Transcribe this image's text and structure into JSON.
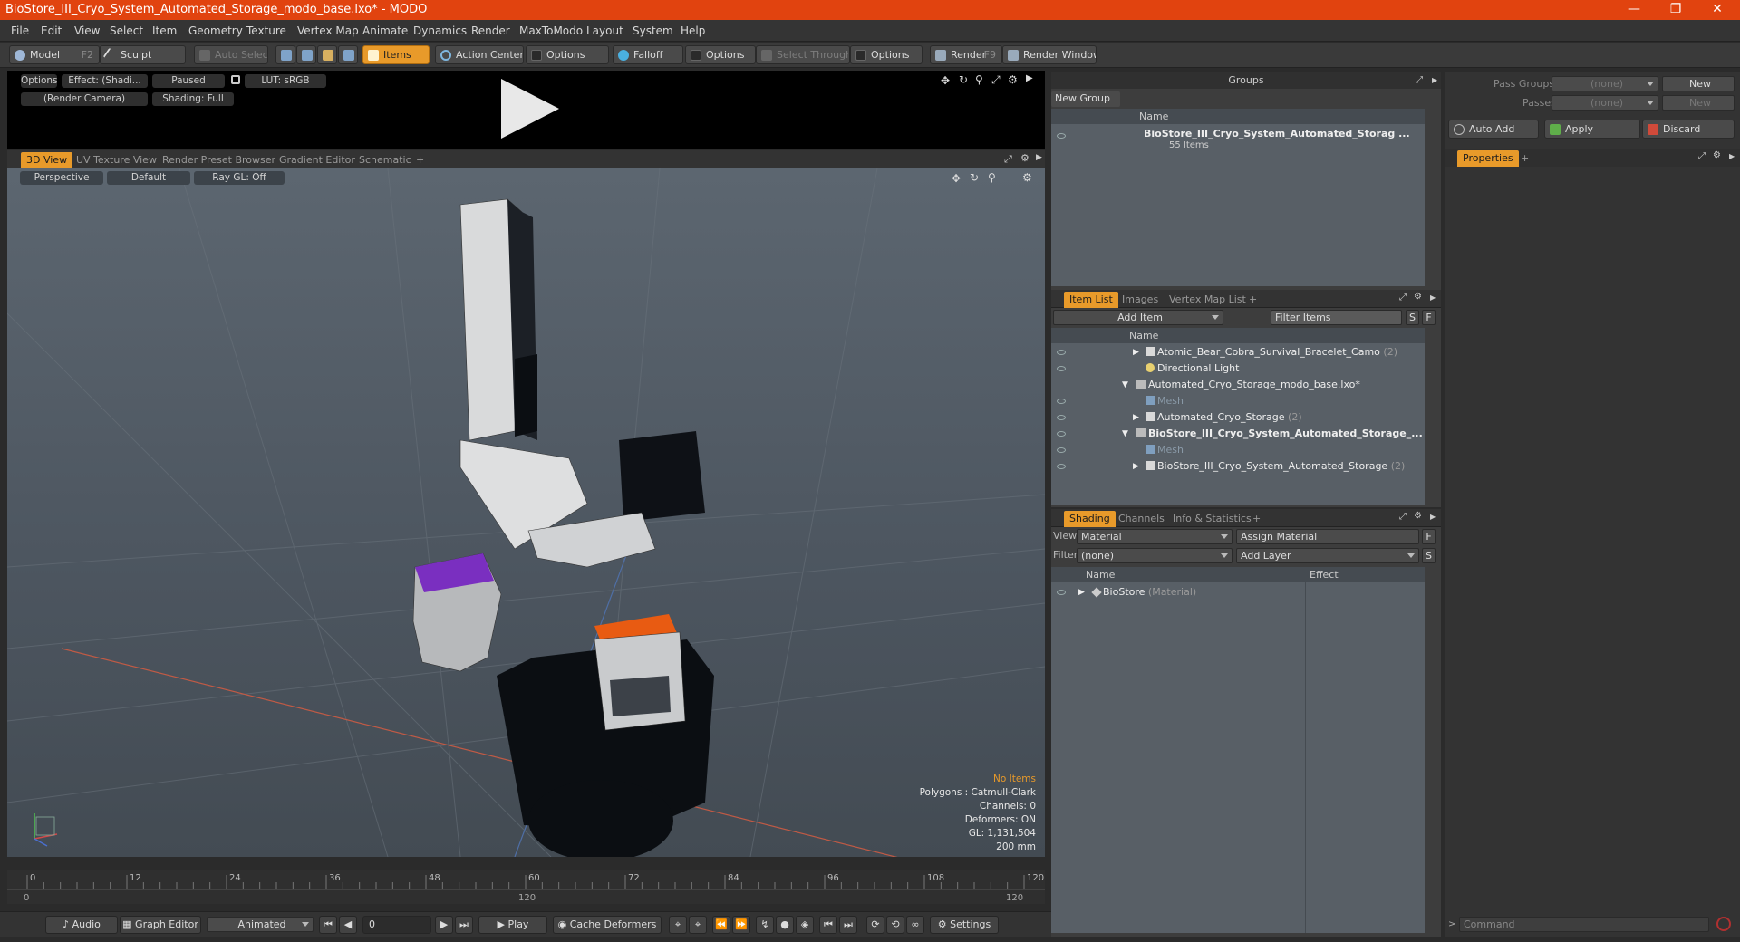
{
  "window": {
    "title": "BioStore_III_Cryo_System_Automated_Storage_modo_base.lxo* - MODO",
    "minimize": "—",
    "maximize": "❐",
    "close": "✕"
  },
  "menu": [
    "File",
    "Edit",
    "View",
    "Select",
    "Item",
    "Geometry",
    "Texture",
    "Vertex Map",
    "Animate",
    "Dynamics",
    "Render",
    "MaxToModo",
    "Layout",
    "System",
    "Help"
  ],
  "toolbar": {
    "model": "Model",
    "model_key": "F2",
    "sculpt": "Sculpt",
    "auto_select": "Auto Select",
    "items": "Items",
    "action_center": "Action Center",
    "options1": "Options",
    "falloff": "Falloff",
    "options2": "Options",
    "select_through": "Select Through",
    "options3": "Options",
    "render": "Render",
    "render_key": "F9",
    "render_window": "Render Window"
  },
  "anim_preview": {
    "options": "Options",
    "effect": "Effect: (Shadi...",
    "paused": "Paused",
    "lut": "LUT: sRGB",
    "camera": "(Render Camera)",
    "shading": "Shading: Full"
  },
  "viewport_tabs": [
    "3D View",
    "UV Texture View",
    "Render Preset Browser",
    "Gradient Editor",
    "Schematic",
    "+"
  ],
  "viewport": {
    "perspective": "Perspective",
    "default": "Default",
    "raygl": "Ray GL: Off",
    "stats": {
      "no_items": "No Items",
      "polygons": "Polygons : Catmull-Clark",
      "channels": "Channels: 0",
      "deformers": "Deformers: ON",
      "gl": "GL: 1,131,504",
      "scale": "200 mm"
    }
  },
  "timeline": {
    "ticks": [
      "0",
      "12",
      "24",
      "36",
      "48",
      "60",
      "72",
      "84",
      "96",
      "108",
      "120"
    ],
    "start": "0",
    "mid": "120",
    "end": "120"
  },
  "bottombar": {
    "audio": "Audio",
    "graph_editor": "Graph Editor",
    "animated": "Animated",
    "frame": "0",
    "play": "Play",
    "cache_deformers": "Cache Deformers",
    "settings": "Settings"
  },
  "groups": {
    "title": "Groups",
    "new_group": "New Group",
    "col_name": "Name",
    "item_name": "BioStore_III_Cryo_System_Automated_Storag ...",
    "item_count": "55 Items"
  },
  "itemlist_tabs": [
    "Item List",
    "Images",
    "Vertex Map List",
    "+"
  ],
  "itemlist": {
    "add_item": "Add Item",
    "filter": "Filter Items",
    "s": "S",
    "f": "F",
    "col_name": "Name",
    "rows": [
      {
        "label": "Atomic_Bear_Cobra_Survival_Bracelet_Camo",
        "count": "(2)"
      },
      {
        "label": "Directional Light",
        "count": ""
      },
      {
        "label": "Automated_Cryo_Storage_modo_base.lxo*",
        "count": ""
      },
      {
        "label": "Mesh",
        "count": ""
      },
      {
        "label": "Automated_Cryo_Storage",
        "count": "(2)"
      },
      {
        "label": "BioStore_III_Cryo_System_Automated_Storage_...",
        "count": ""
      },
      {
        "label": "Mesh",
        "count": ""
      },
      {
        "label": "BioStore_III_Cryo_System_Automated_Storage",
        "count": "(2)"
      }
    ]
  },
  "shading_tabs": [
    "Shading",
    "Channels",
    "Info & Statistics",
    "+"
  ],
  "shading": {
    "view_label": "View",
    "view_value": "Material",
    "assign_material": "Assign Material",
    "f": "F",
    "filter_label": "Filter",
    "filter_value": "(none)",
    "add_layer": "Add Layer",
    "s": "S",
    "col_name": "Name",
    "col_effect": "Effect",
    "row_name": "BioStore",
    "row_type": "(Material)"
  },
  "right": {
    "pass_groups": "Pass Groups",
    "passes": "Passes",
    "none1": "(none)",
    "none2": "(none)",
    "new1": "New",
    "new2": "New",
    "auto_add": "Auto Add",
    "apply": "Apply",
    "discard": "Discard",
    "properties": "Properties",
    "plus": "+",
    "command": "Command"
  },
  "colors": {
    "accent": "#e89a2a",
    "titlebar": "#e1430f",
    "purple": "#7a2fc0",
    "orange": "#e85b12"
  }
}
